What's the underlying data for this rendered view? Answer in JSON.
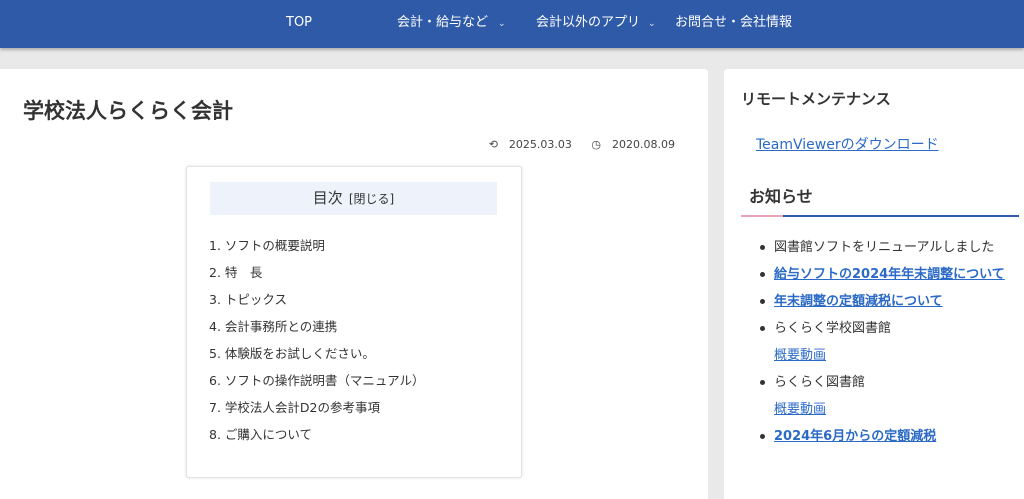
{
  "nav": {
    "items": [
      {
        "label": "TOP"
      },
      {
        "label": "会計・給与など",
        "chevron": true
      },
      {
        "label": "会計以外のアプリ",
        "chevron": true
      },
      {
        "label": "お問合せ・会社情報"
      }
    ]
  },
  "article": {
    "title": "学校法人らくらく会計",
    "updated": "2025.03.03",
    "published": "2020.08.09"
  },
  "toc": {
    "title": "目次",
    "toggle": "[閉じる]",
    "items": [
      "1. ソフトの概要説明",
      "2. 特　長",
      "3. トピックス",
      "4. 会計事務所との連携",
      "5. 体験版をお試しください。",
      "6. ソフトの操作説明書（マニュアル）",
      "7. 学校法人会計D2の参考事項",
      "8. ご購入について"
    ]
  },
  "sidebar": {
    "remote_heading": "リモートメンテナンス",
    "remote_link": "TeamViewerのダウンロード",
    "news_heading": "お知らせ",
    "news": [
      {
        "text": "図書館ソフトをリニューアルしました"
      },
      {
        "link": "給与ソフトの2024年年末調整について"
      },
      {
        "link": "年末調整の定額減税について"
      },
      {
        "text": "らくらく学校図書館",
        "sub_link": "概要動画"
      },
      {
        "text": "らくらく図書館",
        "sub_link": "概要動画"
      },
      {
        "link": "2024年6月からの定額減税"
      }
    ]
  },
  "colors": {
    "nav_bg": "#2f5aa8",
    "link": "#2b6ac7",
    "toc_head_bg": "#eef3fb",
    "accent_pink": "#e9a4b8"
  }
}
